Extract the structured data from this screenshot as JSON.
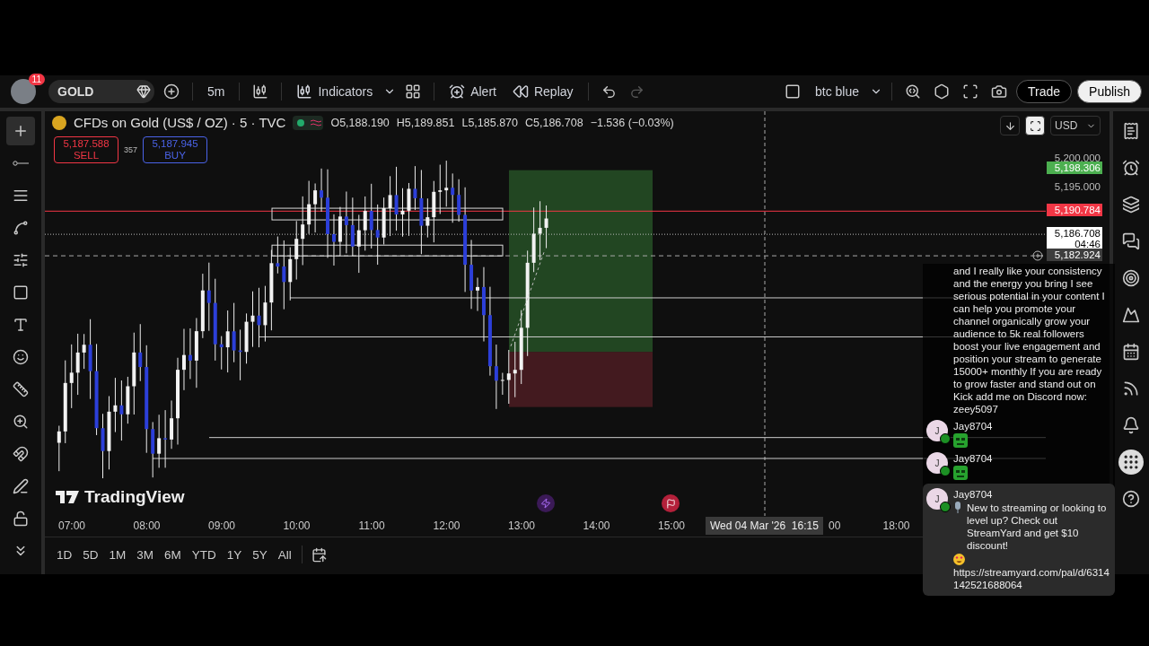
{
  "toolbar": {
    "avatar_badge": "11",
    "symbol": "GOLD",
    "interval": "5m",
    "actions": [
      {
        "kind": "indicators",
        "label": "Indicators"
      },
      {
        "kind": "alert",
        "label": "Alert"
      },
      {
        "kind": "replay",
        "label": "Replay"
      }
    ],
    "layout_name": "btc blue",
    "redo_disabled": true,
    "trade_button": "Trade",
    "publish_button": "Publish"
  },
  "tools": [
    {
      "selected": true
    },
    {
      "selected": false
    },
    {
      "selected": false
    },
    {
      "selected": false
    },
    {
      "selected": false
    },
    {
      "selected": false
    },
    {
      "selected": false
    },
    {
      "selected": false
    },
    {
      "selected": false
    },
    {
      "selected": false
    },
    {
      "selected": false
    },
    {
      "selected": false
    },
    {
      "selected": false
    },
    {
      "selected": false
    }
  ],
  "legend": {
    "title": "CFDs on Gold (US$ / OZ) · 5 · TVC",
    "ohlc": [
      {
        "label": "O",
        "value": "5,188.190"
      },
      {
        "label": "H",
        "value": "5,189.851"
      },
      {
        "label": "L",
        "value": "5,185.870"
      },
      {
        "label": "C",
        "value": "5,186.708"
      }
    ],
    "change": "−1.536 (−0.03%)"
  },
  "order": {
    "sell_price": "5,187.588",
    "sell_label": "SELL",
    "spread": "357",
    "buy_price": "5,187.945",
    "buy_label": "BUY"
  },
  "currency": "USD",
  "price_labels": [
    {
      "kind": "tick",
      "text": "5,200.000"
    },
    {
      "kind": "marker",
      "text": "5,198.306",
      "color": "#4caf50"
    },
    {
      "kind": "tick",
      "text": "5,195.000"
    },
    {
      "kind": "marker",
      "text": "5,190.784",
      "color": "#f23645"
    },
    {
      "kind": "last",
      "text": "5,186.708",
      "sub": "04:46",
      "color": "#ffffff"
    },
    {
      "kind": "crosshair",
      "text": "5,182.924",
      "color": "#3d3d3d"
    }
  ],
  "time_ticks": [
    "07:00",
    "08:00",
    "09:00",
    "10:00",
    "11:00",
    "12:00",
    "13:00",
    "14:00",
    "15:00",
    "00",
    "18:00"
  ],
  "crosshair_time": "Wed 04 Mar '26  16:15",
  "brand": "TradingView",
  "ranges": [
    "1D",
    "5D",
    "1M",
    "3M",
    "6M",
    "YTD",
    "1Y",
    "5Y",
    "All"
  ],
  "chat": [
    {
      "kind": "text",
      "highlighted": false,
      "text": "and I really like your consistency and the energy you bring I see serious potential in your content I can help you promote your channel organically grow your audience to 5k real followers boost your live engagement and position your stream to generate 15000+ monthly If you are ready to grow faster and stand out on Kick add me on Discord now: zeey5097"
    },
    {
      "kind": "emote",
      "highlighted": false,
      "user": "Jay8704",
      "initial": "J"
    },
    {
      "kind": "emote",
      "highlighted": false,
      "user": "Jay8704",
      "initial": "J"
    },
    {
      "kind": "promo",
      "highlighted": true,
      "user": "Jay8704",
      "initial": "J",
      "text": "New to streaming or looking to level up? Check out StreamYard and get $10 discount!",
      "url": "https://streamyard.com/pal/d/6314142521688064"
    }
  ]
}
